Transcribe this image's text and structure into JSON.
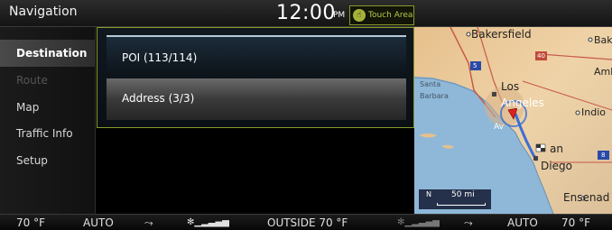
{
  "header": {
    "title": "Navigation",
    "time": "12:00",
    "ampm": "PM",
    "touch_area": "Touch Area"
  },
  "sidebar": {
    "items": [
      {
        "label": "Destination",
        "state": "active"
      },
      {
        "label": "Route",
        "state": "disabled"
      },
      {
        "label": "Map",
        "state": "normal"
      },
      {
        "label": "Traffic Info",
        "state": "normal"
      },
      {
        "label": "Setup",
        "state": "normal"
      }
    ]
  },
  "dialog": {
    "options": [
      {
        "label": "POI (113/114)"
      },
      {
        "label": "Address (3/3)"
      }
    ]
  },
  "map": {
    "labels": [
      "Bakersfield",
      "Baker",
      "Amb",
      "Santa",
      "Barbara",
      "Los",
      "Angeles",
      "Indio",
      "Av",
      "an",
      "Diego",
      "Ensenad"
    ],
    "highways": [
      "5",
      "40",
      "8"
    ],
    "scale": {
      "north": "N",
      "distance": "50 mi"
    }
  },
  "climate": {
    "left_temp": "70 °F",
    "left_mode": "AUTO",
    "outside": "OUTSIDE  70 °F",
    "right_mode": "AUTO",
    "right_temp": "70 °F"
  },
  "colors": {
    "accent": "#8a9a2a",
    "touch_text": "#b9c64a",
    "map_land": "#e9c99a",
    "map_water": "#8fb8d8",
    "route": "#3a6ed8",
    "vehicle": "#e02020"
  }
}
